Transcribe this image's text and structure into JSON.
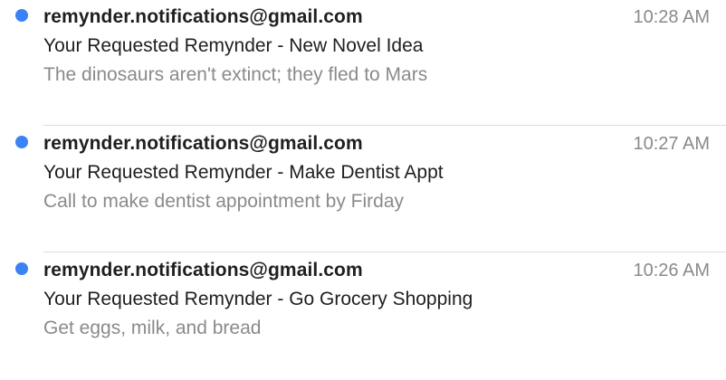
{
  "messages": [
    {
      "unread": true,
      "sender": "remynder.notifications@gmail.com",
      "time": "10:28 AM",
      "subject": "Your Requested Remynder - New Novel Idea",
      "preview": "The dinosaurs aren't extinct; they fled to Mars"
    },
    {
      "unread": true,
      "sender": "remynder.notifications@gmail.com",
      "time": "10:27 AM",
      "subject": "Your Requested Remynder - Make Dentist Appt",
      "preview": "Call to make dentist appointment by Firday"
    },
    {
      "unread": true,
      "sender": "remynder.notifications@gmail.com",
      "time": "10:26 AM",
      "subject": "Your Requested Remynder - Go Grocery Shopping",
      "preview": "Get eggs, milk, and bread"
    }
  ],
  "colors": {
    "unread_dot": "#3b82f6",
    "primary_text": "#1f1f1f",
    "secondary_text": "#8a8a8a",
    "divider": "#dcdcdc"
  }
}
